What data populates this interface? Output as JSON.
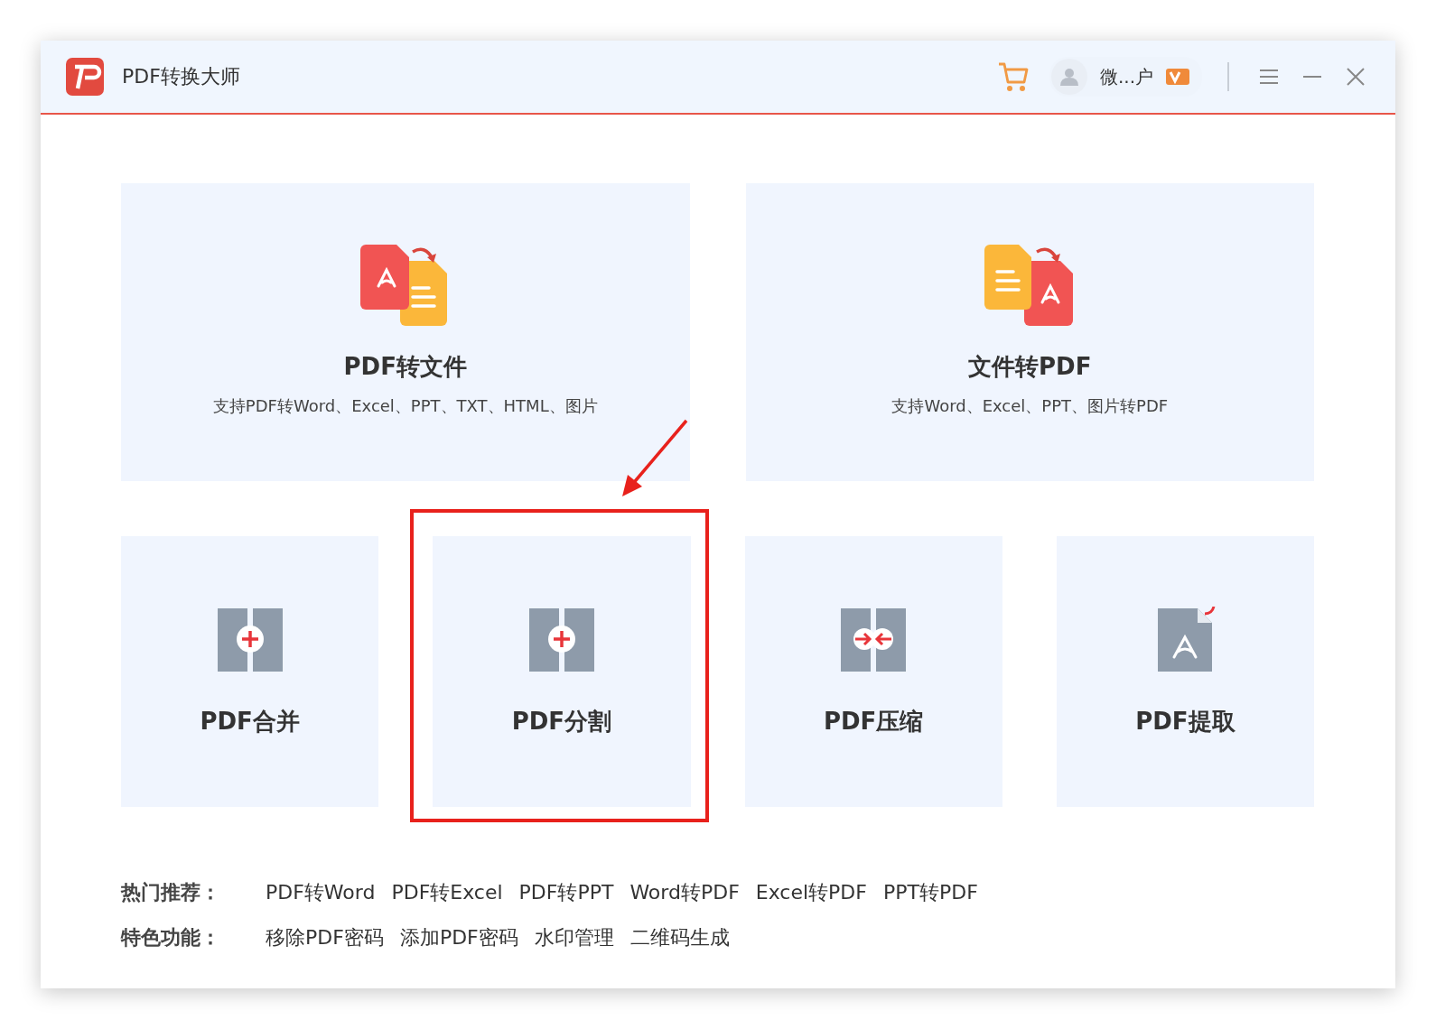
{
  "window": {
    "title": "PDF转换大师",
    "user_name": "微...户"
  },
  "main_tools": [
    {
      "kind": "pdf-to-file",
      "title": "PDF转文件",
      "subtitle": "支持PDF转Word、Excel、PPT、TXT、HTML、图片"
    },
    {
      "kind": "file-to-pdf",
      "title": "文件转PDF",
      "subtitle": "支持Word、Excel、PPT、图片转PDF"
    }
  ],
  "tools": [
    {
      "kind": "merge",
      "title": "PDF合并",
      "highlighted": false
    },
    {
      "kind": "split",
      "title": "PDF分割",
      "highlighted": true
    },
    {
      "kind": "compress",
      "title": "PDF压缩",
      "highlighted": false
    },
    {
      "kind": "extract",
      "title": "PDF提取",
      "highlighted": false
    }
  ],
  "link_rows": [
    {
      "label": "热门推荐：",
      "links": [
        "PDF转Word",
        "PDF转Excel",
        "PDF转PPT",
        "Word转PDF",
        "Excel转PDF",
        "PPT转PDF"
      ]
    },
    {
      "label": "特色功能：",
      "links": [
        "移除PDF密码",
        "添加PDF密码",
        "水印管理",
        "二维码生成"
      ]
    }
  ]
}
